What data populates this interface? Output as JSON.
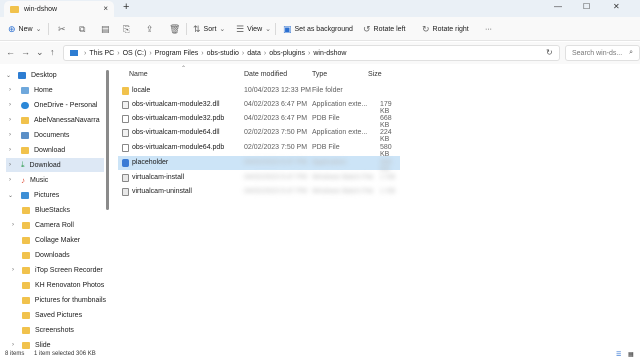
{
  "window": {
    "tab_title": "win-dshow",
    "new_tab": "+",
    "tab_close": "×",
    "minimize": "—",
    "maximize": "☐",
    "close": "✕"
  },
  "toolbar": {
    "new_label": "New",
    "sort_label": "Sort",
    "view_label": "View",
    "background_label": "Set as background",
    "rotate_left_label": "Rotate left",
    "rotate_right_label": "Rotate right",
    "more_label": "···"
  },
  "address": {
    "crumbs": [
      "This PC",
      "OS (C:)",
      "Program Files",
      "obs-studio",
      "data",
      "obs-plugins",
      "win-dshow"
    ],
    "search_placeholder": "Search win-ds..."
  },
  "sidebar": {
    "items": [
      {
        "label": "Desktop",
        "icon": "desktop-icon"
      },
      {
        "label": "Home",
        "icon": "home-icon"
      },
      {
        "label": "OneDrive - Personal",
        "icon": "cloud-icon"
      },
      {
        "label": "AbelVanessaNavarra",
        "icon": "folder-icon"
      },
      {
        "label": "Documents",
        "icon": "documents-icon"
      },
      {
        "label": "Download",
        "icon": "folder-icon"
      },
      {
        "label": "Download",
        "icon": "download-icon"
      },
      {
        "label": "Music",
        "icon": "music-icon"
      },
      {
        "label": "Pictures",
        "icon": "pictures-icon"
      },
      {
        "label": "BlueStacks",
        "icon": "folder-icon"
      },
      {
        "label": "Camera Roll",
        "icon": "folder-icon"
      },
      {
        "label": "Collage Maker",
        "icon": "folder-icon"
      },
      {
        "label": "Downloads",
        "icon": "folder-icon"
      },
      {
        "label": "iTop Screen Recorder",
        "icon": "folder-icon"
      },
      {
        "label": "KH Renovaton Photos",
        "icon": "folder-icon"
      },
      {
        "label": "Pictures for thumbnails",
        "icon": "folder-icon"
      },
      {
        "label": "Saved Pictures",
        "icon": "folder-icon"
      },
      {
        "label": "Screenshots",
        "icon": "folder-icon"
      },
      {
        "label": "Slide",
        "icon": "folder-icon"
      }
    ]
  },
  "columns": {
    "name": "Name",
    "date": "Date modified",
    "type": "Type",
    "size": "Size"
  },
  "files": [
    {
      "name": "locale",
      "date": "10/04/2023 12:33 PM",
      "type": "File folder",
      "size": ""
    },
    {
      "name": "obs-virtualcam-module32.dll",
      "date": "04/02/2023 6:47 PM",
      "type": "Application exte...",
      "size": "179 KB"
    },
    {
      "name": "obs-virtualcam-module32.pdb",
      "date": "04/02/2023 6:47 PM",
      "type": "PDB File",
      "size": "668 KB"
    },
    {
      "name": "obs-virtualcam-module64.dll",
      "date": "02/02/2023 7:50 PM",
      "type": "Application exte...",
      "size": "224 KB"
    },
    {
      "name": "obs-virtualcam-module64.pdb",
      "date": "02/02/2023 7:50 PM",
      "type": "PDB File",
      "size": "580 KB"
    },
    {
      "name": "placeholder",
      "date": "04/02/2023 6:47 PM",
      "type": "Application",
      "size": "306 KB"
    },
    {
      "name": "virtualcam-install",
      "date": "04/02/2023 6:47 PM",
      "type": "Windows Batch File",
      "size": "1 KB"
    },
    {
      "name": "virtualcam-uninstall",
      "date": "04/02/2023 6:47 PM",
      "type": "Windows Batch File",
      "size": "1 KB"
    }
  ],
  "status": {
    "item_count": "8 items",
    "selection": "1 item selected  306 KB"
  },
  "colors": {
    "accent": "#2b6fd1",
    "folder": "#f1c24c",
    "selection": "#cce4f7"
  }
}
